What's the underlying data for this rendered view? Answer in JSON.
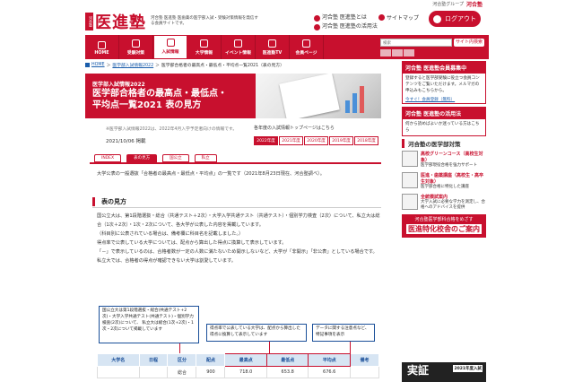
{
  "topbar": {
    "group_label": "河合塾グループ",
    "brand": "河合塾"
  },
  "logo": {
    "mark": "河合塾",
    "name": "医進塾",
    "tagline": "河合塾 医進塾 医歯薬の医学部入試・受験対策情報を発信する会員サイトです。"
  },
  "header_links": [
    "河合塾 医進塾とは",
    "河合塾 医進塾の活用法"
  ],
  "sitemap_label": "サイトマップ",
  "login_label": "ログアウト",
  "nav": [
    {
      "label": "HOME",
      "active": false
    },
    {
      "label": "受験対策",
      "active": false
    },
    {
      "label": "入試情報",
      "active": true
    },
    {
      "label": "大学情報",
      "active": false
    },
    {
      "label": "イベント情報",
      "active": false
    },
    {
      "label": "医進塾TV",
      "active": false
    },
    {
      "label": "会員ページ",
      "active": false
    },
    {
      "label": "",
      "active": false
    }
  ],
  "search": {
    "placeholder": "検索",
    "button": "サイト内検索"
  },
  "breadcrumb": [
    "HOME",
    "医学部入試情報2022",
    "医学部合格者の最高点・最低点・平均点一覧2021（表の見方）"
  ],
  "hero": {
    "category": "医学部入試情報2022",
    "title_line1": "医学部合格者の最高点・最低点・",
    "title_line2": "平均点一覧2021 表の見方"
  },
  "note": "※医学部入試情報2022は、2022年4月入学予定者向けの情報です。",
  "date": "2021/10/06 掲載",
  "side_note": "各年度の入試情報トップページはこちら",
  "years": [
    {
      "label": "2022年度",
      "selected": true
    },
    {
      "label": "2021年度",
      "selected": false
    },
    {
      "label": "2020年度",
      "selected": false
    },
    {
      "label": "2019年度",
      "selected": false
    },
    {
      "label": "2018年度",
      "selected": false
    }
  ],
  "tabs": [
    {
      "label": "INDEX",
      "selected": false
    },
    {
      "label": "表の見方",
      "selected": true
    },
    {
      "label": "国公立",
      "selected": false
    },
    {
      "label": "私立",
      "selected": false
    }
  ],
  "intro": "大学公表の一般選抜「合格者の最高点・最低点・平均点」の一覧です（2021年8月23日現在、河合塾調べ）。",
  "section_title": "表の見方",
  "body_lines": [
    "国公立大は、第1段階選抜・総合（共通テスト＋2次）・大学入学共通テスト（共通テスト）・個別学力検査（2次）について、私立大は総合（1次＋2次）・1次・2次について、各大学が公表した内容を掲載しています。",
    "（科目別に公表されている場合は、備考欄に科目名を記載しました。）",
    "得点率で公表している大学については、配点から算出した得点に換算して表示しています。",
    "「－」で表示しているのは、合格者数が一定の人数に満たないため開示しないなど、大学が「非開示」「非公表」としている場合です。",
    "私立大では、合格者の得点が確認できない大学は割愛しています。"
  ],
  "callouts": [
    {
      "head": "国公立大は第1段階選抜・総合(共通テスト+2次)・大学入学共通テスト(共通テスト)・個別学力検査(2次)について、",
      "text": "私立大は総合(1次+2次)・1次・2次について掲載しています"
    },
    {
      "head": "",
      "text": "得点率で公表している大学は、配点から算出した得点に換算して表示しています"
    },
    {
      "head": "",
      "text": "データに関する注意点など、特記事項を表示"
    }
  ],
  "table": {
    "headers": [
      "大学名",
      "日程",
      "区分",
      "配点",
      "最高点",
      "最低点",
      "平均点",
      "備考"
    ],
    "row": [
      "",
      "",
      "総合",
      "900",
      "718.0",
      "653.8",
      "676.6",
      ""
    ]
  },
  "right": {
    "promo1": {
      "head": "河合塾 医進塾会員募集中",
      "text": "登録すると医学部受験に役立つ会員コンテンツをご覧いただけます。メルマガの申込みもこちらから。",
      "link": "今すぐ！会員登録（無料）"
    },
    "promo2": {
      "head": "河合塾 医進塾の活用法",
      "text": "何から読めばよいか迷っている方はこちら"
    },
    "programs_head": "河合塾の医学部対策",
    "programs": [
      {
        "title": "高校グリーンコース（高校生対象）",
        "sub": "医学部現役合格を強力サポート"
      },
      {
        "title": "医進・歯薬講座（高校生・高卒生対象）",
        "sub": "医学部合格に特化した講座"
      },
      {
        "title": "全統模試案内",
        "sub": "大学入試に必要な学力を測定し、合格へのアドバイスを提供"
      }
    ],
    "banner": {
      "a": "河合塾医学部科合格をめざす",
      "b": "医進特化校舎のご案内"
    },
    "footer": {
      "text": "実証",
      "year": "2021年度入試"
    }
  }
}
